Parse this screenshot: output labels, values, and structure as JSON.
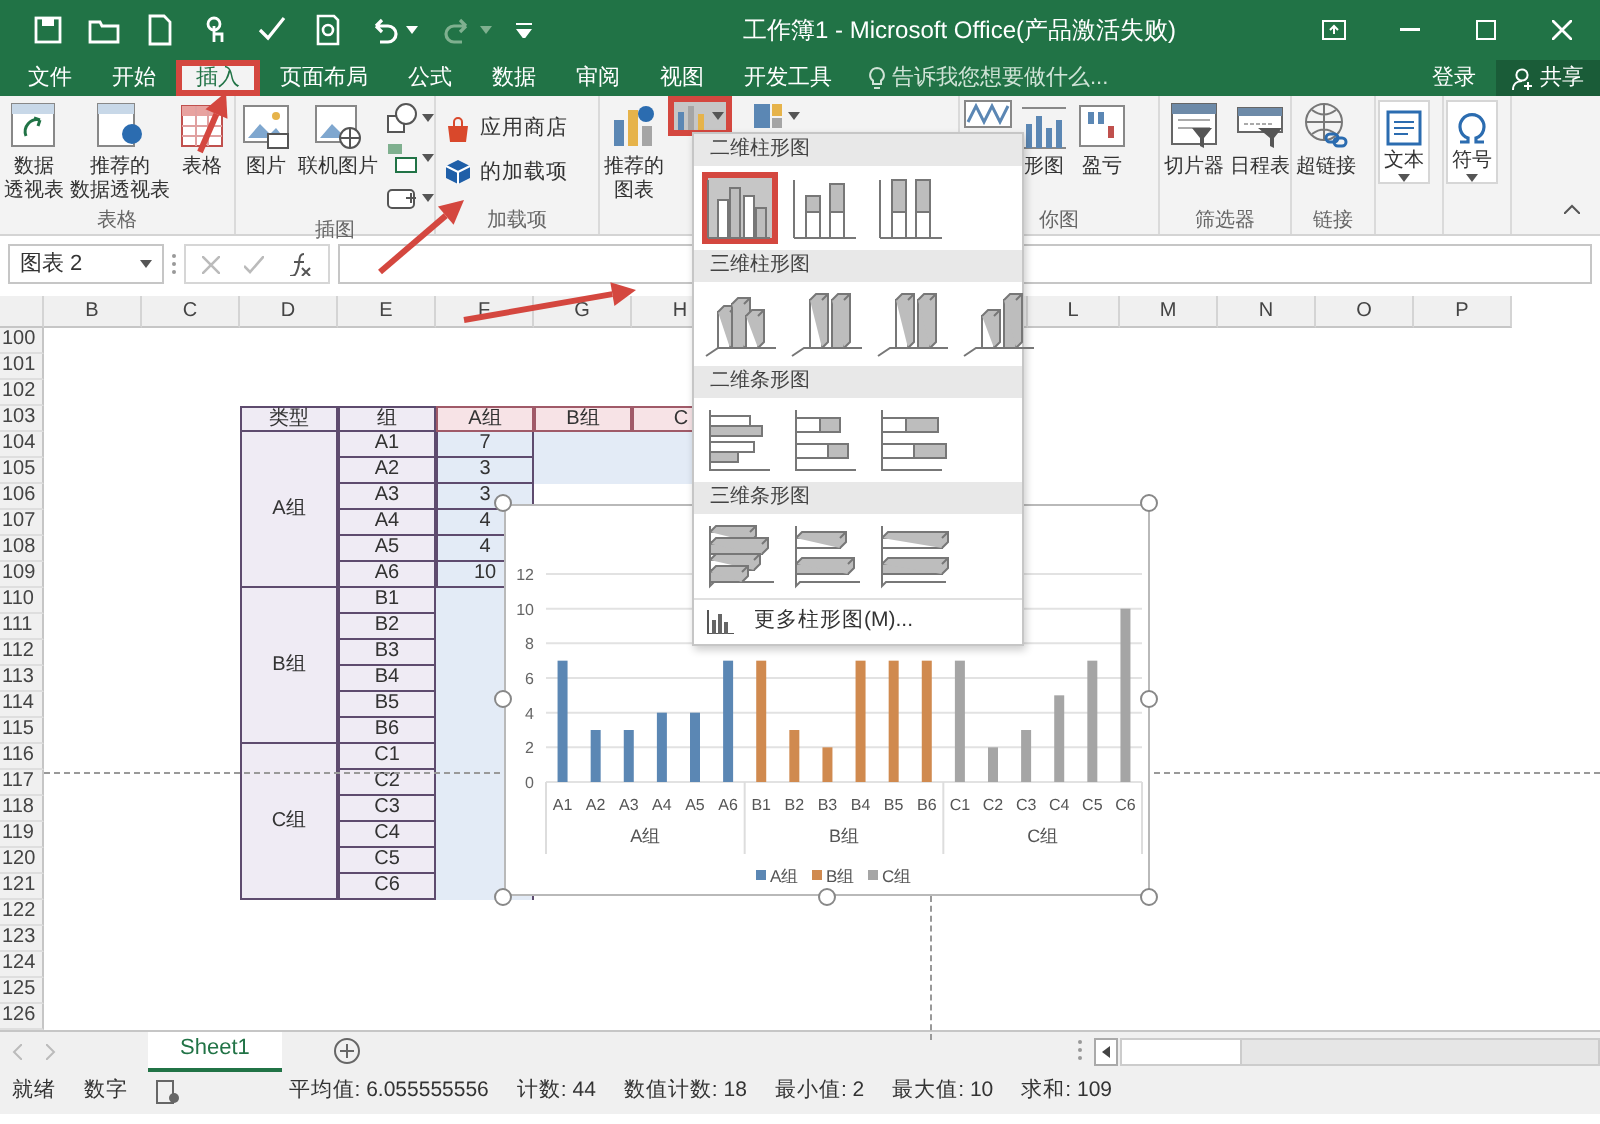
{
  "title_bar": {
    "title": "工作簿1 - Microsoft Office(产品激活失败)"
  },
  "ribbon_tabs": [
    {
      "label": "文件",
      "selected": false,
      "annotated": false
    },
    {
      "label": "开始",
      "selected": false,
      "annotated": false
    },
    {
      "label": "插入",
      "selected": true,
      "annotated": true
    },
    {
      "label": "页面布局",
      "selected": false,
      "annotated": false
    },
    {
      "label": "公式",
      "selected": false,
      "annotated": false
    },
    {
      "label": "数据",
      "selected": false,
      "annotated": false
    },
    {
      "label": "审阅",
      "selected": false,
      "annotated": false
    },
    {
      "label": "视图",
      "selected": false,
      "annotated": false
    },
    {
      "label": "开发工具",
      "selected": false,
      "annotated": false
    }
  ],
  "tell_me": {
    "placeholder": "告诉我您想要做什么..."
  },
  "sign_in": "登录",
  "share": "共享",
  "ribbon_groups": [
    {
      "label": "表格",
      "buttons": [
        {
          "kind": "large",
          "lines": [
            "数据",
            "透视表"
          ]
        },
        {
          "kind": "large",
          "lines": [
            "推荐的",
            "数据透视表"
          ]
        },
        {
          "kind": "large",
          "lines": [
            "表格"
          ]
        }
      ]
    },
    {
      "label": "插图",
      "buttons": [
        {
          "kind": "large",
          "lines": [
            "图片"
          ]
        },
        {
          "kind": "large",
          "lines": [
            "联机图片"
          ]
        },
        {
          "kind": "icons"
        }
      ]
    },
    {
      "label": "加载项",
      "buttons": [
        {
          "kind": "small",
          "text": "应用商店"
        },
        {
          "kind": "small",
          "text": "的加载项"
        }
      ]
    },
    {
      "buttons": [
        {
          "kind": "large",
          "lines": [
            "推荐的",
            "图表"
          ]
        },
        {
          "kind": "chart-menu",
          "expanded": true,
          "annotated": true
        },
        {
          "kind": "chart-menu",
          "expanded": false,
          "annotated": false
        }
      ]
    },
    {
      "label": "你图",
      "buttons": [
        {
          "kind": "icon"
        },
        {
          "kind": "large",
          "lines": [
            "形图"
          ]
        },
        {
          "kind": "large",
          "lines": [
            "盈亏"
          ]
        }
      ]
    },
    {
      "label": "筛选器",
      "buttons": [
        {
          "kind": "large",
          "lines": [
            "切片器"
          ]
        },
        {
          "kind": "large",
          "lines": [
            "日程表"
          ]
        }
      ]
    },
    {
      "label": "链接",
      "buttons": [
        {
          "kind": "large",
          "lines": [
            "超链接"
          ]
        }
      ]
    },
    {
      "buttons": [
        {
          "kind": "large-menu",
          "lines": [
            "文本"
          ]
        }
      ]
    },
    {
      "buttons": [
        {
          "kind": "large-menu",
          "lines": [
            "符号"
          ]
        }
      ]
    }
  ],
  "formula_bar": {
    "name_box": "图表 2"
  },
  "sheet": {
    "columns": [
      "B",
      "C",
      "D",
      "E",
      "F",
      "G",
      "H"
    ],
    "columns_right": [
      "L",
      "M",
      "N",
      "O",
      "P"
    ],
    "rows": [
      "100",
      "101",
      "102",
      "103",
      "104",
      "105",
      "106",
      "107",
      "108",
      "109",
      "110",
      "111",
      "112",
      "113",
      "114",
      "115",
      "116",
      "117",
      "118",
      "119",
      "120",
      "121",
      "122",
      "123",
      "124",
      "125",
      "126"
    ],
    "data_table": {
      "headers": [
        "类型",
        "组",
        "A组",
        "B组",
        "C"
      ],
      "groups": [
        {
          "label": "A组",
          "items": [
            {
              "name": "A1",
              "value": "7"
            },
            {
              "name": "A2",
              "value": "3"
            },
            {
              "name": "A3",
              "value": "3"
            },
            {
              "name": "A4",
              "value": "4"
            },
            {
              "name": "A5",
              "value": "4"
            },
            {
              "name": "A6",
              "value": "10"
            }
          ]
        },
        {
          "label": "B组",
          "items": [
            {
              "name": "B1"
            },
            {
              "name": "B2"
            },
            {
              "name": "B3"
            },
            {
              "name": "B4"
            },
            {
              "name": "B5"
            },
            {
              "name": "B6"
            }
          ]
        },
        {
          "label": "C组",
          "items": [
            {
              "name": "C1"
            },
            {
              "name": "C2"
            },
            {
              "name": "C3"
            },
            {
              "name": "C4"
            },
            {
              "name": "C5"
            },
            {
              "name": "C6"
            }
          ]
        }
      ]
    }
  },
  "chart": {
    "group_labels": [
      "A组",
      "B组",
      "C组"
    ],
    "chart_data": {
      "type": "bar",
      "categories": [
        "A1",
        "A2",
        "A3",
        "A4",
        "A5",
        "A6",
        "B1",
        "B2",
        "B3",
        "B4",
        "B5",
        "B6",
        "C1",
        "C2",
        "C3",
        "C4",
        "C5",
        "C6"
      ],
      "series": [
        {
          "name": "A组",
          "color": "#5b87b4",
          "values": [
            7,
            3,
            3,
            4,
            4,
            7,
            null,
            null,
            null,
            null,
            null,
            null,
            null,
            null,
            null,
            null,
            null,
            null
          ]
        },
        {
          "name": "B组",
          "color": "#d08a4f",
          "values": [
            null,
            null,
            null,
            null,
            null,
            null,
            7,
            3,
            2,
            7,
            7,
            7,
            null,
            null,
            null,
            null,
            null,
            null
          ]
        },
        {
          "name": "C组",
          "color": "#a5a5a5",
          "values": [
            null,
            null,
            null,
            null,
            null,
            null,
            null,
            null,
            null,
            null,
            null,
            null,
            7,
            2,
            3,
            5,
            7,
            10
          ]
        }
      ],
      "ylim": [
        0,
        12
      ],
      "yticks": [
        0,
        2,
        4,
        6,
        8,
        10,
        12
      ],
      "grid": true,
      "legend": "bottom"
    }
  },
  "chart_type_menu": {
    "sections": [
      {
        "title": "二维柱形图",
        "kind": "column",
        "options": [
          {
            "selected": true,
            "annotated": true
          },
          {
            "selected": false,
            "annotated": false
          },
          {
            "selected": false,
            "annotated": false
          }
        ]
      },
      {
        "title": "三维柱形图",
        "kind": "column3d",
        "options": [
          {
            "selected": false,
            "annotated": false
          },
          {
            "selected": false,
            "annotated": false
          },
          {
            "selected": false,
            "annotated": false
          },
          {
            "selected": false,
            "annotated": false
          }
        ]
      },
      {
        "title": "二维条形图",
        "kind": "bar",
        "options": [
          {
            "selected": false,
            "annotated": false
          },
          {
            "selected": false,
            "annotated": false
          },
          {
            "selected": false,
            "annotated": false
          }
        ]
      },
      {
        "title": "三维条形图",
        "kind": "bar3d",
        "options": [
          {
            "selected": false,
            "annotated": false
          },
          {
            "selected": false,
            "annotated": false
          },
          {
            "selected": false,
            "annotated": false
          }
        ]
      }
    ],
    "more": "更多柱形图(M)..."
  },
  "sheet_tabs": [
    {
      "label": "Sheet1",
      "selected": true
    }
  ],
  "status_bar": {
    "mode": "就绪",
    "input_mode": "数字",
    "stats": [
      "平均值: 6.055555556",
      "计数: 44",
      "数值计数: 18",
      "最小值: 2",
      "最大值: 10",
      "求和: 109"
    ]
  }
}
